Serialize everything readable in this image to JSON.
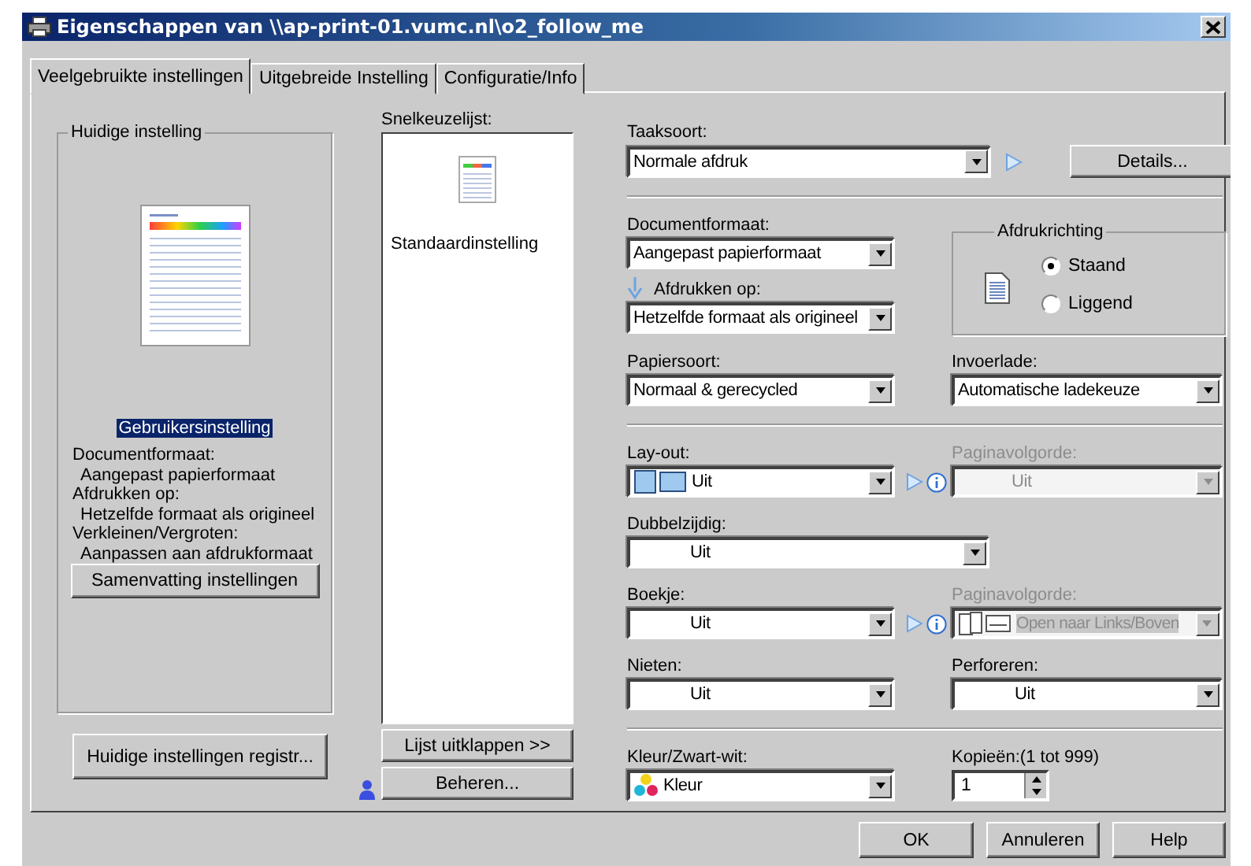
{
  "window": {
    "title": "Eigenschappen van \\\\ap-print-01.vumc.nl\\o2_follow_me"
  },
  "tabs": [
    {
      "label": "Veelgebruikte instellingen",
      "selected": true
    },
    {
      "label": "Uitgebreide Instelling",
      "selected": false
    },
    {
      "label": "Configuratie/Info",
      "selected": false
    }
  ],
  "current_settings": {
    "title": "Huidige instelling",
    "setting": {
      "label": "Gebruikersinstelling",
      "selected": true
    },
    "summary": [
      {
        "kind": "label",
        "text": "Documentformaat:"
      },
      {
        "kind": "value",
        "text": "Aangepast papierformaat"
      },
      {
        "kind": "label",
        "text": "Afdrukken op:"
      },
      {
        "kind": "value",
        "text": "Hetzelfde formaat als origineel"
      },
      {
        "kind": "label",
        "text": "Verkleinen/Vergroten:"
      },
      {
        "kind": "value",
        "text": "Aanpassen aan afdrukformaat"
      }
    ],
    "summary_button": "Samenvatting instellingen"
  },
  "register_button": "Huidige instellingen registr...",
  "quick_list": {
    "label": "Snelkeuzelijst:",
    "items": [
      {
        "label": "Standaardinstelling",
        "selected": false
      }
    ],
    "expand_button": "Lijst uitklappen >>",
    "manage_button": "Beheren..."
  },
  "job": {
    "label": "Taaksoort:",
    "value": "Normale afdruk",
    "details_button": "Details..."
  },
  "document_size": {
    "label": "Documentformaat:",
    "value": "Aangepast papierformaat"
  },
  "print_on": {
    "label": "Afdrukken op:",
    "value": "Hetzelfde formaat als origineel"
  },
  "orientation": {
    "title": "Afdrukrichting",
    "options": [
      {
        "label": "Staand",
        "selected": true
      },
      {
        "label": "Liggend",
        "selected": false
      }
    ]
  },
  "paper_type": {
    "label": "Papiersoort:",
    "value": "Normaal & gerecycled"
  },
  "input_tray": {
    "label": "Invoerlade:",
    "value": "Automatische ladekeuze"
  },
  "layout": {
    "label": "Lay-out:",
    "value": "Uit",
    "kind": "layout"
  },
  "layout_order": {
    "label": "Paginavolgorde:",
    "value": "Uit",
    "kind": "indented",
    "disabled": true
  },
  "duplex": {
    "label": "Dubbelzijdig:",
    "value": "Uit",
    "kind": "indented"
  },
  "booklet": {
    "label": "Boekje:",
    "value": "Uit",
    "kind": "indented"
  },
  "booklet_order": {
    "label": "Paginavolgorde:",
    "value": "Open naar Links/Boven",
    "kind": "booklet",
    "disabled": true
  },
  "staple": {
    "label": "Nieten:",
    "value": "Uit",
    "kind": "indented"
  },
  "punch": {
    "label": "Perforeren:",
    "value": "Uit",
    "kind": "indented"
  },
  "color_mode": {
    "label": "Kleur/Zwart-wit:",
    "value": "Kleur",
    "kind": "color"
  },
  "copies": {
    "label": "Kopieën:(1 tot 999)",
    "value": "1"
  },
  "footer_buttons": [
    "OK",
    "Annuleren",
    "Help"
  ]
}
